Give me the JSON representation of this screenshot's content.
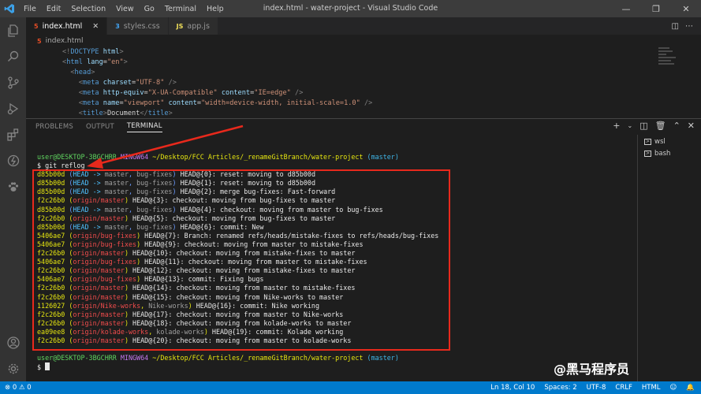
{
  "titlebar": {
    "menu": [
      "File",
      "Edit",
      "Selection",
      "View",
      "Go",
      "Terminal",
      "Help"
    ],
    "title": "index.html - water-project - Visual Studio Code"
  },
  "tabs": [
    {
      "label": "index.html",
      "icon": "html-file-icon",
      "active": true
    },
    {
      "label": "styles.css",
      "icon": "css-file-icon",
      "active": false
    },
    {
      "label": "app.js",
      "icon": "js-file-icon",
      "active": false
    }
  ],
  "breadcrumb": "index.html",
  "code": {
    "line1": [
      "<!",
      "DOCTYPE",
      " html",
      ">"
    ],
    "line2": [
      "<",
      "html",
      " lang",
      "=",
      "\"en\"",
      ">"
    ],
    "line3": [
      "<",
      "head",
      ">"
    ],
    "line4": [
      "<",
      "meta",
      " charset",
      "=",
      "\"UTF-8\"",
      " />"
    ],
    "line5": [
      "<",
      "meta",
      " http-equiv",
      "=",
      "\"X-UA-Compatible\"",
      " content",
      "=",
      "\"IE=edge\"",
      " />"
    ],
    "line6": [
      "<",
      "meta",
      " name",
      "=",
      "\"viewport\"",
      " content",
      "=",
      "\"width=device-width, initial-scale=1.0\"",
      " />"
    ],
    "line7": [
      "<",
      "title",
      ">",
      "Document",
      "</",
      "title",
      ">"
    ]
  },
  "panel": {
    "tabs": [
      "PROBLEMS",
      "OUTPUT",
      "TERMINAL"
    ],
    "terminals": [
      "wsl",
      "bash"
    ]
  },
  "terminal": {
    "prompt": {
      "user": "user@DESKTOP-3BGCHRR",
      "shell": "MINGW64",
      "path": "~/Desktop/FCC Articles/_renameGitBranch/water-project",
      "branch": "(master)"
    },
    "command": "$ git reflog",
    "final_prompt": "$ ",
    "entries": [
      {
        "hash": "d85b00d",
        "refs": [
          [
            "(",
            "p"
          ],
          [
            "HEAD -> ",
            "h"
          ],
          [
            "master",
            "r"
          ],
          [
            ", ",
            "p"
          ],
          [
            "bug-fixes",
            "r"
          ],
          [
            ")",
            "p"
          ]
        ],
        "msg": " HEAD@{0}: reset: moving to d85b00d"
      },
      {
        "hash": "d85b00d",
        "refs": [
          [
            "(",
            "p"
          ],
          [
            "HEAD -> ",
            "h"
          ],
          [
            "master",
            "r"
          ],
          [
            ", ",
            "p"
          ],
          [
            "bug-fixes",
            "r"
          ],
          [
            ")",
            "p"
          ]
        ],
        "msg": " HEAD@{1}: reset: moving to d85b00d"
      },
      {
        "hash": "d85b00d",
        "refs": [
          [
            "(",
            "p"
          ],
          [
            "HEAD -> ",
            "h"
          ],
          [
            "master",
            "r"
          ],
          [
            ", ",
            "p"
          ],
          [
            "bug-fixes",
            "r"
          ],
          [
            ")",
            "p"
          ]
        ],
        "msg": " HEAD@{2}: merge bug-fixes: Fast-forward"
      },
      {
        "hash": "f2c26b0",
        "refs": [
          [
            "(",
            "y"
          ],
          [
            "origin/master",
            "o"
          ],
          [
            ")",
            "y"
          ]
        ],
        "msg": " HEAD@{3}: checkout: moving from bug-fixes to master"
      },
      {
        "hash": "d85b00d",
        "refs": [
          [
            "(",
            "p"
          ],
          [
            "HEAD -> ",
            "h"
          ],
          [
            "master",
            "r"
          ],
          [
            ", ",
            "p"
          ],
          [
            "bug-fixes",
            "r"
          ],
          [
            ")",
            "p"
          ]
        ],
        "msg": " HEAD@{4}: checkout: moving from master to bug-fixes"
      },
      {
        "hash": "f2c26b0",
        "refs": [
          [
            "(",
            "y"
          ],
          [
            "origin/master",
            "o"
          ],
          [
            ")",
            "y"
          ]
        ],
        "msg": " HEAD@{5}: checkout: moving from bug-fixes to master"
      },
      {
        "hash": "d85b00d",
        "refs": [
          [
            "(",
            "p"
          ],
          [
            "HEAD -> ",
            "h"
          ],
          [
            "master",
            "r"
          ],
          [
            ", ",
            "p"
          ],
          [
            "bug-fixes",
            "r"
          ],
          [
            ")",
            "p"
          ]
        ],
        "msg": " HEAD@{6}: commit: New"
      },
      {
        "hash": "5406ae7",
        "refs": [
          [
            "(",
            "y"
          ],
          [
            "origin/bug-fixes",
            "o"
          ],
          [
            ")",
            "y"
          ]
        ],
        "msg": " HEAD@{7}: Branch: renamed refs/heads/mistake-fixes to refs/heads/bug-fixes"
      },
      {
        "hash": "5406ae7",
        "refs": [
          [
            "(",
            "y"
          ],
          [
            "origin/bug-fixes",
            "o"
          ],
          [
            ")",
            "y"
          ]
        ],
        "msg": " HEAD@{9}: checkout: moving from master to mistake-fixes"
      },
      {
        "hash": "f2c26b0",
        "refs": [
          [
            "(",
            "y"
          ],
          [
            "origin/master",
            "o"
          ],
          [
            ")",
            "y"
          ]
        ],
        "msg": " HEAD@{10}: checkout: moving from mistake-fixes to master"
      },
      {
        "hash": "5406ae7",
        "refs": [
          [
            "(",
            "y"
          ],
          [
            "origin/bug-fixes",
            "o"
          ],
          [
            ")",
            "y"
          ]
        ],
        "msg": " HEAD@{11}: checkout: moving from master to mistake-fixes"
      },
      {
        "hash": "f2c26b0",
        "refs": [
          [
            "(",
            "y"
          ],
          [
            "origin/master",
            "o"
          ],
          [
            ")",
            "y"
          ]
        ],
        "msg": " HEAD@{12}: checkout: moving from mistake-fixes to master"
      },
      {
        "hash": "5406ae7",
        "refs": [
          [
            "(",
            "y"
          ],
          [
            "origin/bug-fixes",
            "o"
          ],
          [
            ")",
            "y"
          ]
        ],
        "msg": " HEAD@{13}: commit: Fixing bugs"
      },
      {
        "hash": "f2c26b0",
        "refs": [
          [
            "(",
            "y"
          ],
          [
            "origin/master",
            "o"
          ],
          [
            ")",
            "y"
          ]
        ],
        "msg": " HEAD@{14}: checkout: moving from master to mistake-fixes"
      },
      {
        "hash": "f2c26b0",
        "refs": [
          [
            "(",
            "y"
          ],
          [
            "origin/master",
            "o"
          ],
          [
            ")",
            "y"
          ]
        ],
        "msg": " HEAD@{15}: checkout: moving from Nike-works to master"
      },
      {
        "hash": "1126027",
        "refs": [
          [
            "(",
            "y"
          ],
          [
            "origin/Nike-works",
            "o"
          ],
          [
            ", ",
            "y"
          ],
          [
            "Nike-works",
            "r"
          ],
          [
            ")",
            "y"
          ]
        ],
        "msg": " HEAD@{16}: commit: Nike working"
      },
      {
        "hash": "f2c26b0",
        "refs": [
          [
            "(",
            "y"
          ],
          [
            "origin/master",
            "o"
          ],
          [
            ")",
            "y"
          ]
        ],
        "msg": " HEAD@{17}: checkout: moving from master to Nike-works"
      },
      {
        "hash": "f2c26b0",
        "refs": [
          [
            "(",
            "y"
          ],
          [
            "origin/master",
            "o"
          ],
          [
            ")",
            "y"
          ]
        ],
        "msg": " HEAD@{18}: checkout: moving from kolade-works to master"
      },
      {
        "hash": "ea09ee8",
        "refs": [
          [
            "(",
            "y"
          ],
          [
            "origin/kolade-works",
            "o"
          ],
          [
            ", ",
            "y"
          ],
          [
            "kolade-works",
            "r"
          ],
          [
            ")",
            "y"
          ]
        ],
        "msg": " HEAD@{19}: commit: Kolade working"
      },
      {
        "hash": "f2c26b0",
        "refs": [
          [
            "(",
            "y"
          ],
          [
            "origin/master",
            "o"
          ],
          [
            ")",
            "y"
          ]
        ],
        "msg": " HEAD@{20}: checkout: moving from master to kolade-works"
      }
    ]
  },
  "watermark": "@黑马程序员",
  "statusbar": {
    "errors": "0",
    "warnings": "0",
    "position": "Ln 18, Col 10",
    "spaces": "Spaces: 2",
    "encoding": "UTF-8",
    "eol": "CRLF",
    "language": "HTML"
  },
  "colors": {
    "accent": "#007acc",
    "annotation": "#e8291c"
  }
}
